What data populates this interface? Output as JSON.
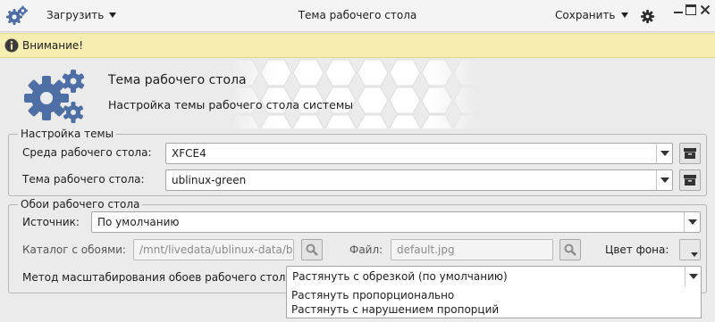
{
  "titlebar": {
    "load_label": "Загрузить",
    "title": "Тема рабочего стола",
    "save_label": "Сохранить"
  },
  "warning": {
    "text": "Внимание!"
  },
  "banner": {
    "title": "Тема рабочего стола",
    "subtitle": "Настройка темы рабочего стола системы"
  },
  "theme_group": {
    "legend": "Настройка темы",
    "desktop_env_label": "Среда рабочего стола:",
    "desktop_env_value": "XFCE4",
    "desktop_theme_label": "Тема рабочего стола:",
    "desktop_theme_value": "ublinux-green"
  },
  "wallpaper_group": {
    "legend": "Обои рабочего стола",
    "source_label": "Источник:",
    "source_value": "По умолчанию",
    "folder_label": "Каталог с обоями:",
    "folder_value": "/mnt/livedata/ublinux-data/bac",
    "file_label": "Файл:",
    "file_value": "default.jpg",
    "bg_color_label": "Цвет фона:",
    "scaling_label": "Метод масштабирования обоев рабочего стола:",
    "scaling_value": "Растянуть с обрезкой (по умолчанию)",
    "scaling_options": [
      "Растянуть пропорционально",
      "Растянуть с нарушением пропорций"
    ]
  },
  "colors": {
    "icon_blue": "#4e6fa6",
    "warning_bg": "#f6edb0",
    "window_bg": "#ebebeb"
  },
  "icons": [
    "app-gear-icon",
    "chevron-down-icon",
    "settings-gear-icon",
    "minimize-icon",
    "maximize-icon",
    "close-icon",
    "info-icon",
    "gears-icon",
    "archive-icon",
    "search-icon"
  ]
}
